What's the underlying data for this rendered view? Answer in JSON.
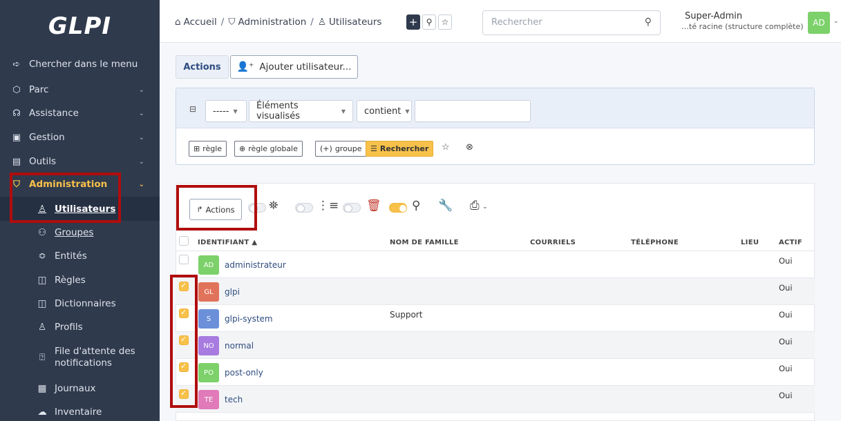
{
  "sidebar": {
    "logo": "GLPI",
    "items": [
      {
        "label": "Chercher dans le menu",
        "icon": "arrow-right-icon"
      },
      {
        "label": "Parc",
        "icon": "box-icon"
      },
      {
        "label": "Assistance",
        "icon": "headset-icon"
      },
      {
        "label": "Gestion",
        "icon": "wallet-icon"
      },
      {
        "label": "Outils",
        "icon": "briefcase-icon"
      },
      {
        "label": "Administration",
        "icon": "shield-icon"
      }
    ],
    "submenu": [
      {
        "label": "Utilisateurs",
        "icon": "user-icon"
      },
      {
        "label": "Groupes",
        "icon": "users-icon"
      },
      {
        "label": "Entités",
        "icon": "stack-icon"
      },
      {
        "label": "Règles",
        "icon": "book-icon"
      },
      {
        "label": "Dictionnaires",
        "icon": "book-icon"
      },
      {
        "label": "Profils",
        "icon": "user-check-icon"
      },
      {
        "label_line1": "File d'attente des",
        "label_line2": "notifications",
        "icon": "bell-icon"
      },
      {
        "label": "Journaux",
        "icon": "news-icon"
      },
      {
        "label": "Inventaire",
        "icon": "cloud-upload-icon"
      }
    ]
  },
  "header": {
    "breadcrumb": [
      "Accueil",
      "Administration",
      "Utilisateurs"
    ],
    "search_placeholder": "Rechercher",
    "user_name": "Super-Admin",
    "user_entity": "…té racine (structure complète)",
    "user_initials": "AD"
  },
  "toolbar": {
    "actions_tab": "Actions",
    "add_user": "Ajouter utilisateur..."
  },
  "criteria": {
    "operator": "-----",
    "field": "Éléments visualisés",
    "condition": "contient",
    "value": "",
    "rule_btn": "règle",
    "global_rule_btn": "règle globale",
    "group_btn": "groupe",
    "search_btn": "Rechercher"
  },
  "results": {
    "mass_actions": "Actions",
    "columns": [
      "IDENTIFIANT",
      "NOM DE FAMILLE",
      "COURRIELS",
      "TÉLÉPHONE",
      "LIEU",
      "ACTIF"
    ],
    "rows": [
      {
        "initials": "AD",
        "login": "administrateur",
        "lastname": "",
        "active": "Oui",
        "checked": false,
        "color": "#7cd16a"
      },
      {
        "initials": "GL",
        "login": "glpi",
        "lastname": "",
        "active": "Oui",
        "checked": true,
        "color": "#e0735a"
      },
      {
        "initials": "S",
        "login": "glpi-system",
        "lastname": "Support",
        "active": "Oui",
        "checked": true,
        "color": "#6b8fd9"
      },
      {
        "initials": "NO",
        "login": "normal",
        "lastname": "",
        "active": "Oui",
        "checked": true,
        "color": "#a77be0"
      },
      {
        "initials": "PO",
        "login": "post-only",
        "lastname": "",
        "active": "Oui",
        "checked": true,
        "color": "#7cd16a"
      },
      {
        "initials": "TE",
        "login": "tech",
        "lastname": "",
        "active": "Oui",
        "checked": true,
        "color": "#e07ab8"
      }
    ]
  }
}
